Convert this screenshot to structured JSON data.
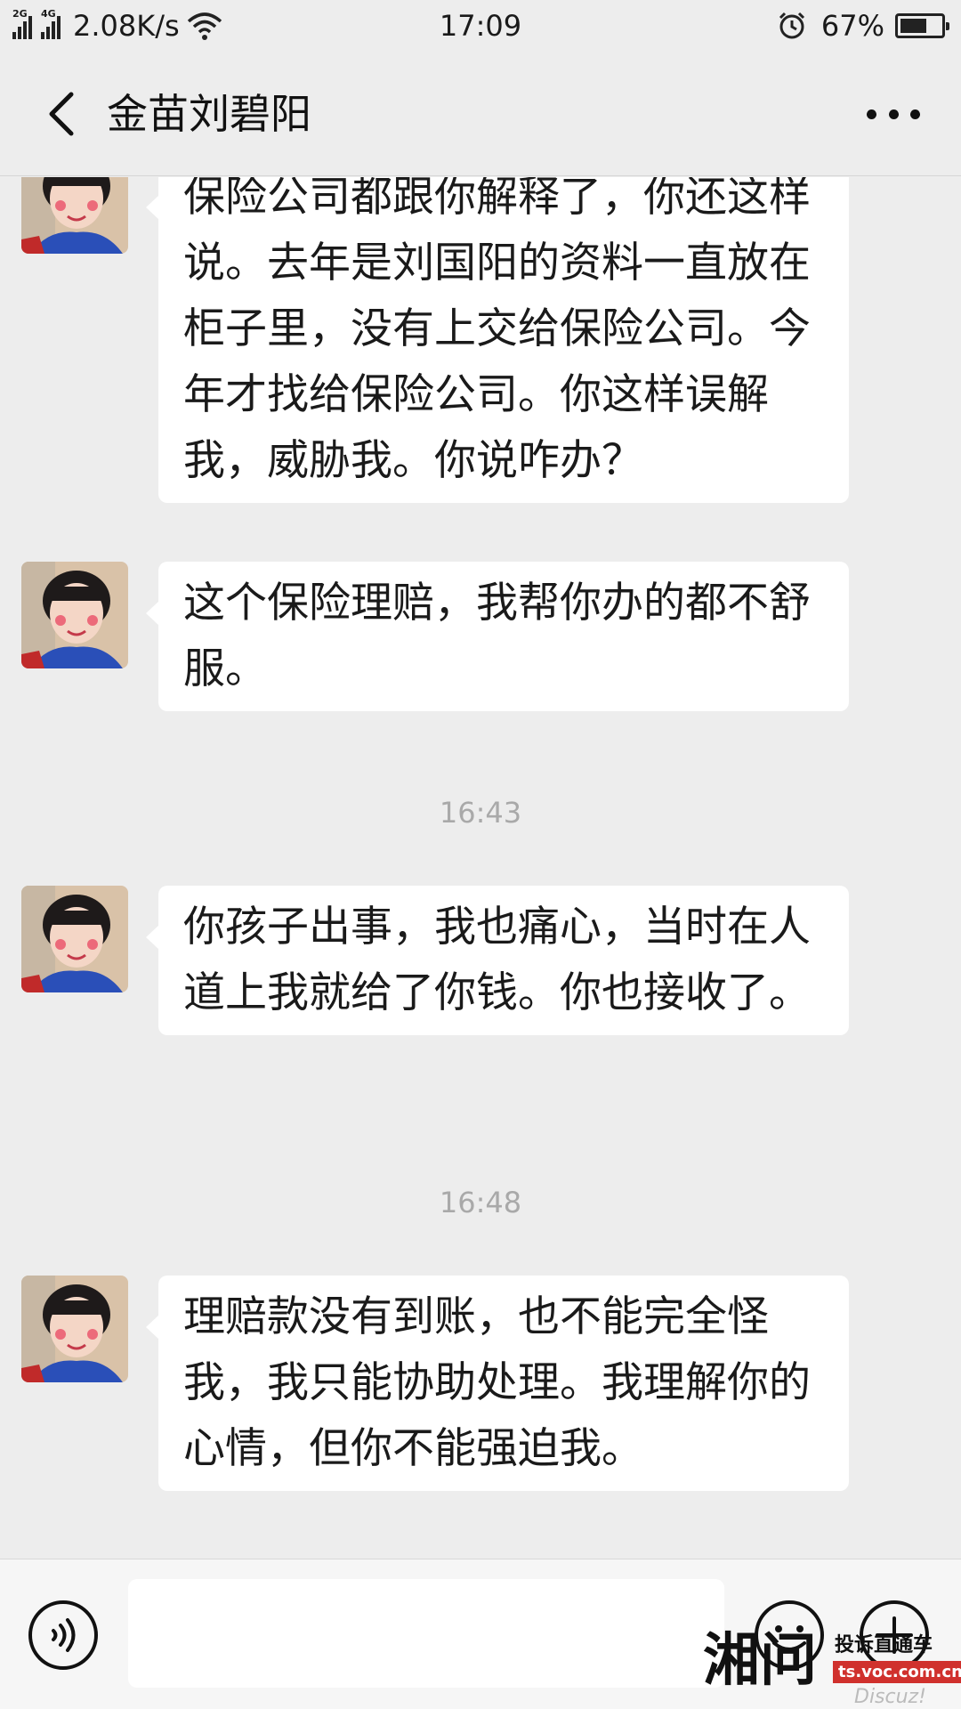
{
  "status_bar": {
    "network_2g": "2G",
    "network_4g": "4G",
    "speed": "2.08K/s",
    "time": "17:09",
    "battery": "67%",
    "battery_level": 0.67
  },
  "header": {
    "title": "金苗刘碧阳"
  },
  "messages": [
    {
      "type": "text",
      "text": "保险公司都跟你解释了，你还这样说。去年是刘国阳的资料一直放在柜子里，没有上交给保险公司。今年才找给保险公司。你这样误解我，威胁我。你说咋办？"
    },
    {
      "type": "text",
      "text": " 这个保险理赔，我帮你办的都不舒服。"
    },
    {
      "type": "time",
      "text": "16:43"
    },
    {
      "type": "text",
      "text": "你孩子出事，我也痛心，当时在人道上我就给了你钱。你也接收了。"
    },
    {
      "type": "time",
      "text": "16:48"
    },
    {
      "type": "text",
      "text": "理赔款没有到账，也不能完全怪我，我只能协助处理。我理解你的心情，但你不能强迫我。"
    }
  ],
  "watermark": {
    "logo": "湘问",
    "tagline": "投诉直通车",
    "url": "ts.voc.com.cn",
    "discuz": "Discuz!"
  },
  "colors": {
    "background": "#ededed",
    "bubble": "#ffffff",
    "timestamp": "#a9a9a9",
    "watermark_red": "#d0312d"
  },
  "icons": [
    "back-arrow-icon",
    "more-dots-icon",
    "voice-icon",
    "emoji-icon",
    "plus-icon",
    "alarm-icon",
    "wifi-icon",
    "battery-icon"
  ]
}
